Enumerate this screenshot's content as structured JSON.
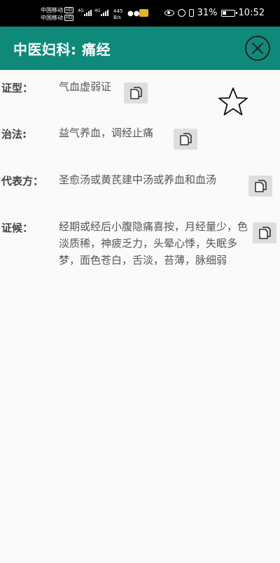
{
  "status_bar": {
    "carrier1": "中国移动",
    "carrier2": "中国移动",
    "hd": "HD",
    "net1": "4G",
    "net2": "4G",
    "speed_value": "445",
    "speed_unit": "B/s",
    "battery": "31%",
    "time": "10:52"
  },
  "appbar": {
    "title": "中医妇科: 痛经"
  },
  "fields": {
    "zhengxing": {
      "label": "证型：",
      "value": "气血虚弱证"
    },
    "zhifa": {
      "label": "治法:",
      "value": "益气养血，调经止痛"
    },
    "daibiaofang": {
      "label": "代表方：",
      "value": "圣愈汤或黄芪建中汤或养血和血汤"
    },
    "zhenghou": {
      "label": "证候：",
      "value": "经期或经后小腹隐痛喜按，月经量少，色淡质稀，神疲乏力，头晕心悸，失眠多梦，面色苍白，舌淡，苔薄，脉细弱"
    }
  },
  "icons": {
    "close": "close-circle-icon",
    "favorite": "star-outline-icon",
    "copy": "copy-icon"
  },
  "colors": {
    "appbar": "#0f8a7a",
    "status_bar": "#000000",
    "background": "#fafafa",
    "copy_button": "#dddddd"
  }
}
